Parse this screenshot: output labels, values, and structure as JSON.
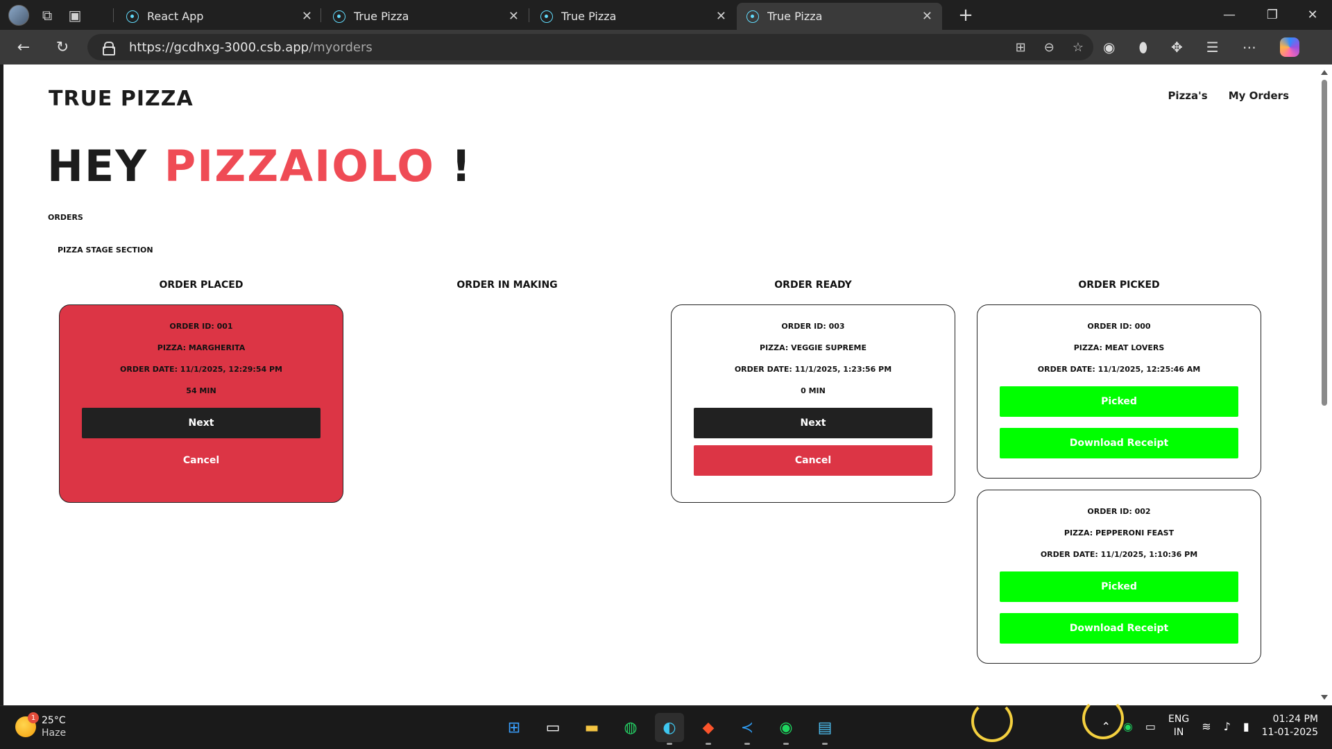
{
  "browser": {
    "tabs": [
      {
        "label": "React App",
        "active": false
      },
      {
        "label": "True Pizza",
        "active": false
      },
      {
        "label": "True Pizza",
        "active": false
      },
      {
        "label": "True Pizza",
        "active": true
      }
    ],
    "url_host": "https://gcdhxg-3000.csb.app",
    "url_path": "/myorders",
    "accent": "#61dafb"
  },
  "page": {
    "brand": "TRUE PIZZA",
    "nav": [
      "Pizza's",
      "My Orders"
    ],
    "hero_prefix": "HEY ",
    "hero_name": "PIZZAIOLO",
    "hero_suffix": " !",
    "orders_label": "ORDERS",
    "stage_label": "PIZZA STAGE SECTION",
    "colors": {
      "accent_red": "#ef4b55",
      "card_red": "#dc3545",
      "dark": "#212121",
      "green": "#00ff00"
    }
  },
  "columns": [
    {
      "title": "ORDER PLACED",
      "cards": [
        {
          "id": "ORDER ID: 001",
          "pizza": "PIZZA: MARGHERITA",
          "date": "ORDER DATE: 11/1/2025, 12:29:54 PM",
          "time": "54 MIN",
          "next": "Next",
          "cancel": "Cancel"
        }
      ]
    },
    {
      "title": "ORDER IN MAKING",
      "cards": []
    },
    {
      "title": "ORDER READY",
      "cards": [
        {
          "id": "ORDER ID: 003",
          "pizza": "PIZZA: VEGGIE SUPREME",
          "date": "ORDER DATE: 11/1/2025, 1:23:56 PM",
          "time": "0 MIN",
          "next": "Next",
          "cancel": "Cancel"
        }
      ]
    },
    {
      "title": "ORDER PICKED",
      "cards": [
        {
          "id": "ORDER ID: 000",
          "pizza": "PIZZA: MEAT LOVERS",
          "date": "ORDER DATE: 11/1/2025, 12:25:46 AM",
          "picked": "Picked",
          "receipt": "Download Receipt"
        },
        {
          "id": "ORDER ID: 002",
          "pizza": "PIZZA: PEPPERONI FEAST",
          "date": "ORDER DATE: 11/1/2025, 1:10:36 PM",
          "picked": "Picked",
          "receipt": "Download Receipt"
        }
      ]
    }
  ],
  "taskbar": {
    "weather_badge": "1",
    "temp": "25°C",
    "condition": "Haze",
    "lang": "ENG",
    "region": "IN",
    "time": "01:24 PM",
    "date": "11-01-2025"
  }
}
